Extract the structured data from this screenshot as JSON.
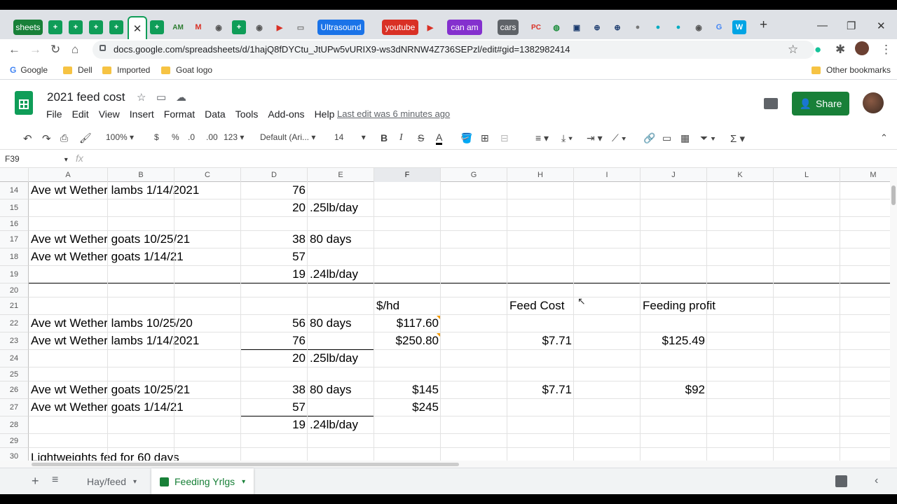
{
  "browser": {
    "tabs": [
      {
        "label": "sheets",
        "color": "#188038"
      },
      {
        "label": "Ultrasound",
        "color": "#1a73e8"
      },
      {
        "label": "youtube",
        "color": "#d93025"
      },
      {
        "label": "can am",
        "color": "#8430ce"
      },
      {
        "label": "cars",
        "color": "#5f6368"
      }
    ],
    "url": "docs.google.com/spreadsheets/d/1hajQ8fDYCtu_JtUPw5vURIX9-ws3dNRNW4Z736SEPzl/edit#gid=1382982414",
    "bookmarks": [
      "Google",
      "Dell",
      "Imported",
      "Goat logo"
    ],
    "other_bookmarks": "Other bookmarks"
  },
  "doc": {
    "title": "2021 feed cost",
    "menu": [
      "File",
      "Edit",
      "View",
      "Insert",
      "Format",
      "Data",
      "Tools",
      "Add-ons",
      "Help"
    ],
    "last_edit": "Last edit was 6 minutes ago",
    "share_label": "Share"
  },
  "toolbar": {
    "zoom": "100%",
    "currency": "$",
    "percent": "%",
    "dec_less": ".0",
    "dec_more": ".00",
    "format": "123",
    "font": "Default (Ari...",
    "font_size": "14",
    "bold": "B",
    "italic": "I",
    "strike": "S",
    "text_color": "A"
  },
  "formula_bar": {
    "name_box": "F39",
    "fx": "fx"
  },
  "grid": {
    "columns": [
      "A",
      "B",
      "C",
      "D",
      "E",
      "F",
      "G",
      "H",
      "I",
      "J",
      "K",
      "L",
      "M"
    ],
    "selected_column": "F",
    "rows": [
      {
        "n": "14",
        "a": "Ave wt Wether lambs 1/14/2021",
        "d": "76",
        "e": "",
        "f": "",
        "h": "",
        "j": ""
      },
      {
        "n": "15",
        "a": "",
        "d": "20",
        "e": ".25lb/day",
        "f": "",
        "h": "",
        "j": ""
      },
      {
        "n": "16",
        "a": "",
        "d": "",
        "e": "",
        "f": "",
        "h": "",
        "j": ""
      },
      {
        "n": "17",
        "a": "Ave wt Wether goats 10/25/21",
        "d": "38",
        "e": "80 days",
        "f": "",
        "h": "",
        "j": ""
      },
      {
        "n": "18",
        "a": "Ave wt Wether goats 1/14/21",
        "d": "57",
        "e": "",
        "f": "",
        "h": "",
        "j": ""
      },
      {
        "n": "19",
        "a": "",
        "d": "19",
        "e": ".24lb/day",
        "f": "",
        "h": "",
        "j": ""
      },
      {
        "n": "20",
        "a": "",
        "d": "",
        "e": "",
        "f": "",
        "h": "",
        "j": ""
      },
      {
        "n": "21",
        "a": "",
        "d": "",
        "e": "",
        "f": "$/hd",
        "h": "Feed Cost",
        "j": "Feeding profit"
      },
      {
        "n": "22",
        "a": "Ave wt Wether lambs 10/25/20",
        "d": "56",
        "e": "80 days",
        "f": "$117.60",
        "h": "",
        "j": ""
      },
      {
        "n": "23",
        "a": "Ave wt Wether lambs 1/14/2021",
        "d": "76",
        "e": "",
        "f": "$250.80",
        "h": "$7.71",
        "j": "$125.49"
      },
      {
        "n": "24",
        "a": "",
        "d": "20",
        "e": ".25lb/day",
        "f": "",
        "h": "",
        "j": ""
      },
      {
        "n": "25",
        "a": "",
        "d": "",
        "e": "",
        "f": "",
        "h": "",
        "j": ""
      },
      {
        "n": "26",
        "a": "Ave wt Wether goats 10/25/21",
        "d": "38",
        "e": "80 days",
        "f": "$145",
        "h": "$7.71",
        "j": "$92"
      },
      {
        "n": "27",
        "a": "Ave wt Wether goats 1/14/21",
        "d": "57",
        "e": "",
        "f": "$245",
        "h": "",
        "j": ""
      },
      {
        "n": "28",
        "a": "",
        "d": "19",
        "e": ".24lb/day",
        "f": "",
        "h": "",
        "j": ""
      },
      {
        "n": "29",
        "a": "",
        "d": "",
        "e": "",
        "f": "",
        "h": "",
        "j": ""
      },
      {
        "n": "30",
        "a": "Lightweights fed for 60 days",
        "d": "",
        "e": "",
        "f": "",
        "h": "",
        "j": ""
      }
    ]
  },
  "sheets": {
    "tabs": [
      "Hay/feed",
      "Feeding Yrlgs"
    ],
    "active": "Feeding Yrlgs"
  }
}
